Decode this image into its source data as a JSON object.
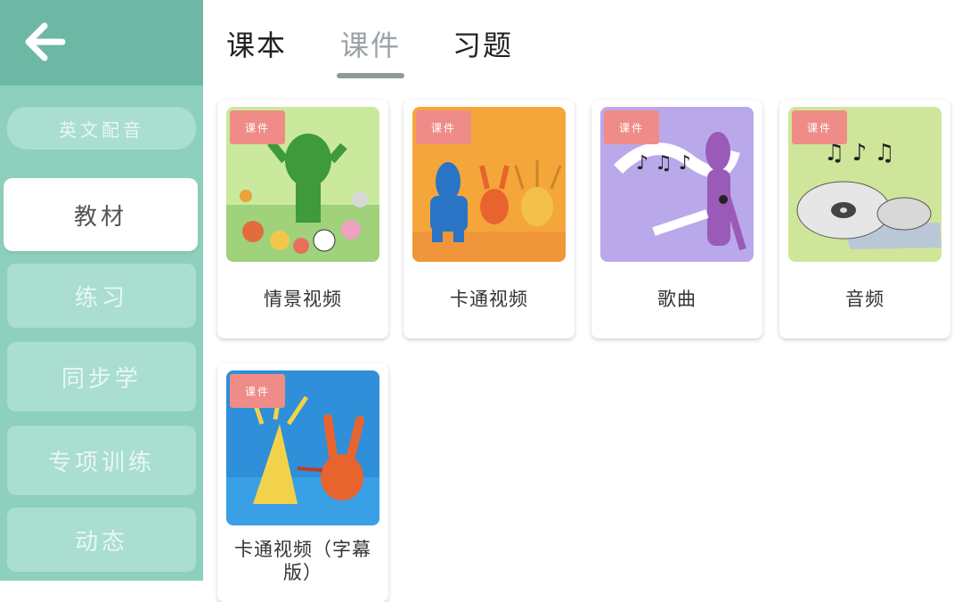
{
  "sidebar": {
    "back_icon": "arrow-left-icon",
    "items": [
      {
        "label": "英文配音"
      },
      {
        "label": "教材"
      },
      {
        "label": "练习"
      },
      {
        "label": "同步学"
      },
      {
        "label": "专项训练"
      },
      {
        "label": "动态"
      }
    ]
  },
  "tabs": [
    {
      "label": "课本"
    },
    {
      "label": "课件"
    },
    {
      "label": "习题"
    }
  ],
  "active_tab": 1,
  "cards": [
    {
      "label": "情景视频",
      "badge": "课件"
    },
    {
      "label": "卡通视频",
      "badge": "课件"
    },
    {
      "label": "歌曲",
      "badge": "课件"
    },
    {
      "label": "音频",
      "badge": "课件"
    },
    {
      "label": "卡通视频（字幕版）",
      "badge": "课件"
    }
  ],
  "colors": {
    "sidebar_bg": "#8dd0bd",
    "sidebar_header": "#6db8a4",
    "badge": "#ef8c88",
    "thumb_green": "#c8e89a",
    "thumb_orange": "#f5a63a",
    "thumb_purple": "#b9a9ea",
    "thumb_lime": "#cfe69a",
    "thumb_blue": "#2f8fd8"
  }
}
